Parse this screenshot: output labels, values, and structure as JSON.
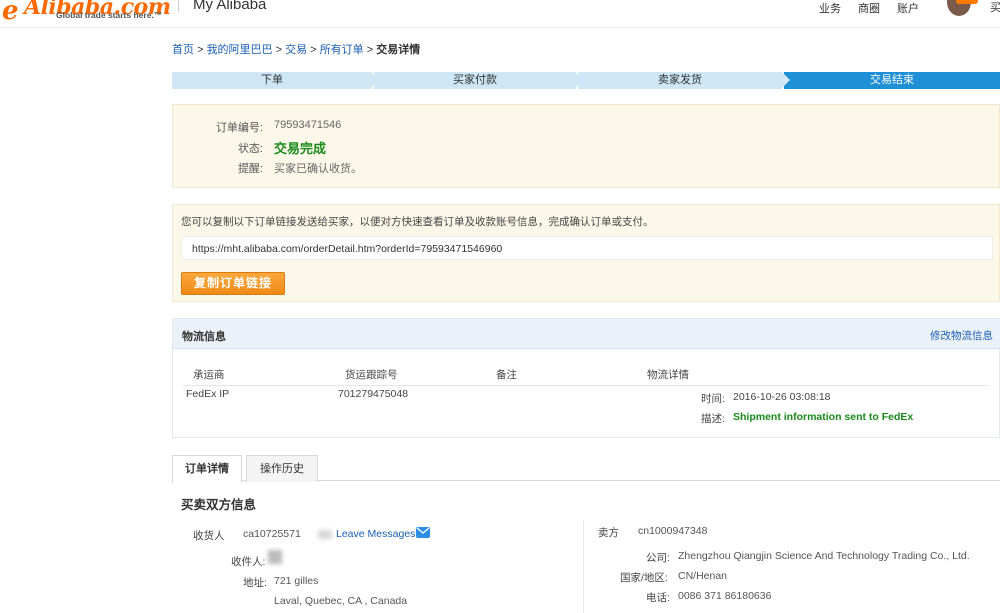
{
  "header": {
    "logo_brand": "Alibaba.com",
    "logo_tagline": "Global trade starts here.™",
    "title": "My Alibaba",
    "nav": [
      "业务",
      "商圈",
      "账户"
    ],
    "badge": "ON",
    "cut_text": "买"
  },
  "breadcrumb": {
    "items": [
      "首页",
      "我的阿里巴巴",
      "交易",
      "所有订单"
    ],
    "separator": ">",
    "current": "交易详情"
  },
  "steps": [
    {
      "label": "下单",
      "active": false
    },
    {
      "label": "买家付款",
      "active": false
    },
    {
      "label": "卖家发货",
      "active": false
    },
    {
      "label": "交易结束",
      "active": true
    }
  ],
  "status": {
    "order_no_label": "订单编号:",
    "order_no": "79593471546",
    "state_label": "状态:",
    "state": "交易完成",
    "tip_label": "提醒:",
    "tip": "买家已确认收货。"
  },
  "share": {
    "tip": "您可以复制以下订单链接发送给买家，以便对方快速查看订单及收款账号信息，完成确认订单或支付。",
    "link": "https://mht.alibaba.com/orderDetail.htm?orderId=79593471546960",
    "copy_button": "复制订单链接"
  },
  "logistics": {
    "title": "物流信息",
    "edit_link": "修改物流信息",
    "columns": [
      "承运商",
      "货运跟踪号",
      "备注",
      "物流详情"
    ],
    "rows": [
      {
        "carrier": "FedEx IP",
        "tracking": "701279475048",
        "remark": "",
        "time_label": "时间:",
        "time": "2016-10-26 03:08:18",
        "desc_label": "描述:",
        "desc": "Shipment information sent to FedEx"
      }
    ]
  },
  "tabs": [
    {
      "label": "订单详情",
      "active": true
    },
    {
      "label": "操作历史",
      "active": false
    }
  ],
  "parties": {
    "title": "买卖双方信息",
    "buyer": {
      "label": "收货人",
      "id": "ca10725571",
      "leave_messages": "Leave Messages",
      "recipient_label": "收件人:",
      "address_label": "地址:",
      "address_line1": "721 gilles",
      "address_line2": "Laval, Quebec, CA , Canada"
    },
    "seller": {
      "label": "卖方",
      "id": "cn1000947348",
      "company_label": "公司:",
      "company": "Zhengzhou Qiangjin Science And Technology Trading Co., Ltd.",
      "region_label": "国家/地区:",
      "region": "CN/Henan",
      "phone_label": "电话:",
      "phone": "0086 371 86180636"
    }
  },
  "colors": {
    "accent_blue": "#1f8fd6",
    "link_blue": "#1a5fb4",
    "success_green": "#1a8a1a",
    "button_orange": "#f08a16",
    "brand_orange": "#ff6a00"
  }
}
